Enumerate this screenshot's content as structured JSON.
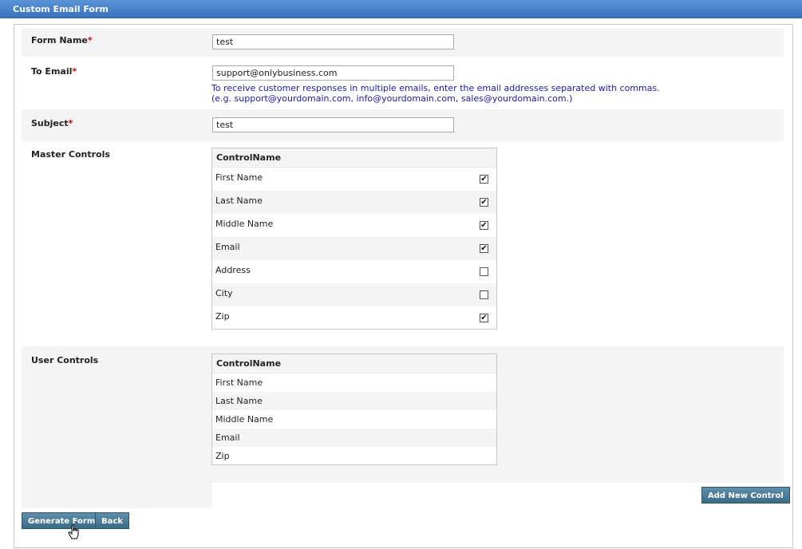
{
  "window": {
    "title": "Custom Email Form"
  },
  "form": {
    "form_name": {
      "label": "Form Name",
      "required_mark": "*",
      "value": "test"
    },
    "to_email": {
      "label": "To Email",
      "required_mark": "*",
      "value": "support@onlybusiness.com",
      "hint_line1": "To receive customer responses in multiple emails, enter the email addresses separated with commas.",
      "hint_line2": "(e.g. support@yourdomain.com, info@yourdomain.com, sales@yourdomain.com.)"
    },
    "subject": {
      "label": "Subject",
      "required_mark": "*",
      "value": "test"
    }
  },
  "master_controls": {
    "label": "Master Controls",
    "column_header": "ControlName",
    "rows": [
      {
        "name": "First Name",
        "checked": true
      },
      {
        "name": "Last Name",
        "checked": true
      },
      {
        "name": "Middle Name",
        "checked": true
      },
      {
        "name": "Email",
        "checked": true
      },
      {
        "name": "Address",
        "checked": false
      },
      {
        "name": "City",
        "checked": false
      },
      {
        "name": "Zip",
        "checked": true
      }
    ]
  },
  "user_controls": {
    "label": "User Controls",
    "column_header": "ControlName",
    "rows": [
      {
        "name": "First Name"
      },
      {
        "name": "Last Name"
      },
      {
        "name": "Middle Name"
      },
      {
        "name": "Email"
      },
      {
        "name": "Zip"
      }
    ]
  },
  "buttons": {
    "add_new_control": "Add New Control",
    "generate_form": "Generate Form",
    "back": "Back"
  },
  "colors": {
    "header_blue": "#3a74bd",
    "button_teal": "#3c6b86",
    "required_red": "#cc0000",
    "hint_blue": "#1a1aa6"
  }
}
